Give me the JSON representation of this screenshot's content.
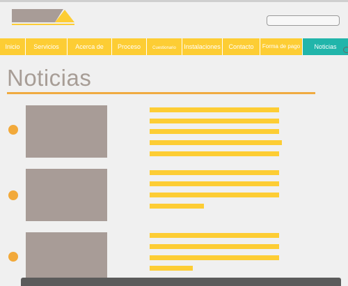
{
  "header": {
    "logo_icon": "logo-shape-icon",
    "search": {
      "placeholder": "",
      "value": ""
    }
  },
  "nav": {
    "items": [
      {
        "label": "Inicio"
      },
      {
        "label": "Servicios"
      },
      {
        "label": "Acerca de"
      },
      {
        "label": "Proceso"
      },
      {
        "label": "Cuestionario"
      },
      {
        "label": "Instalaciones"
      },
      {
        "label": "Contacto"
      },
      {
        "label": "Forma de pago"
      },
      {
        "label": "Noticias",
        "active": true
      }
    ]
  },
  "page": {
    "title": "Noticias"
  },
  "colors": {
    "accent_yellow": "#fdcd34",
    "accent_teal": "#21b5aa",
    "accent_orange": "#f2a93a",
    "thumb_gray": "#a89c97",
    "title_gray": "#a79d96"
  },
  "news": [
    {
      "image_icon": "image-placeholder-icon",
      "bullet_icon": "bullet-icon",
      "text_lines": 5
    },
    {
      "image_icon": "image-placeholder-icon",
      "bullet_icon": "bullet-icon",
      "text_lines": 4
    },
    {
      "image_icon": "image-placeholder-icon",
      "bullet_icon": "bullet-icon",
      "text_lines": 4
    }
  ]
}
